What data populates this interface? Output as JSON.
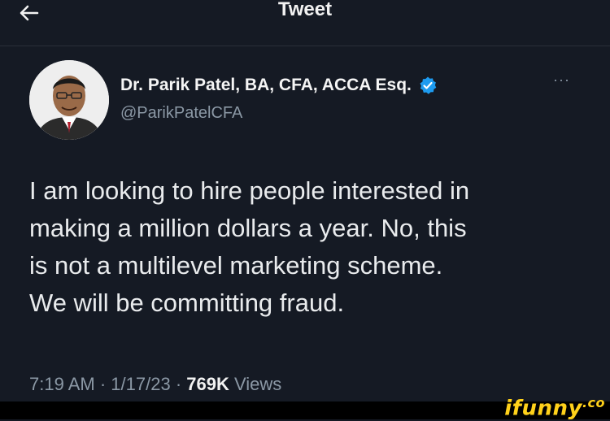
{
  "header": {
    "title": "Tweet",
    "back_icon": "back-arrow-icon"
  },
  "author": {
    "name": "Dr. Parik Patel, BA, CFA, ACCA Esq.",
    "handle": "@ParikPatelCFA",
    "verified_icon": "verified-badge-icon",
    "more_label": "···"
  },
  "tweet": {
    "lines": [
      "I am looking to hire people interested in",
      "making a million dollars a year. No, this",
      "is not a multilevel marketing scheme.",
      "We will be committing fraud."
    ],
    "time": "7:19 AM",
    "date": "1/17/23",
    "views_count": "769K",
    "views_label": "Views",
    "separator": "·"
  },
  "watermark": {
    "text": "ifunny",
    "suffix": ".co"
  },
  "colors": {
    "background": "#151a24",
    "muted": "#8b98a5",
    "accent": "#1d9bf0",
    "watermark": "#ffd11a"
  }
}
